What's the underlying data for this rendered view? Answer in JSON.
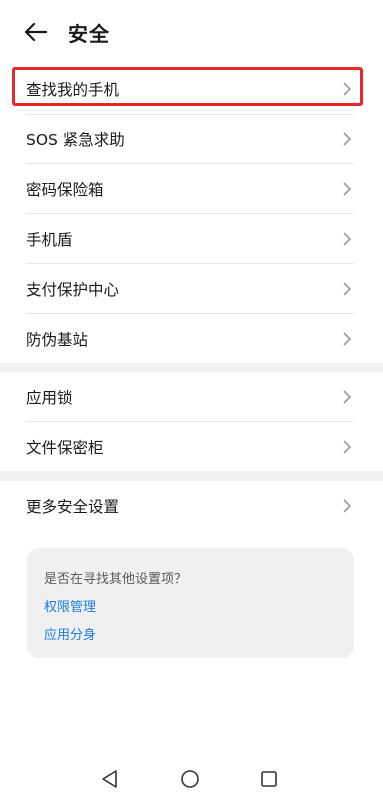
{
  "header": {
    "title": "安全",
    "back_icon": "arrow-left-icon"
  },
  "groups": [
    {
      "items": [
        {
          "label": "查找我的手机",
          "highlighted": true
        },
        {
          "label": "SOS 紧急求助"
        },
        {
          "label": "密码保险箱"
        },
        {
          "label": "手机盾"
        },
        {
          "label": "支付保护中心"
        },
        {
          "label": "防伪基站"
        }
      ]
    },
    {
      "items": [
        {
          "label": "应用锁"
        },
        {
          "label": "文件保密柜"
        }
      ]
    },
    {
      "items": [
        {
          "label": "更多安全设置"
        }
      ]
    }
  ],
  "suggestion": {
    "question": "是否在寻找其他设置项？",
    "links": [
      "权限管理",
      "应用分身"
    ]
  },
  "colors": {
    "highlight_border": "#e8282d",
    "link": "#1a7fe0",
    "background": "#f1f1f1"
  },
  "navbar": {
    "icons": [
      "triangle-back-icon",
      "circle-home-icon",
      "square-recent-icon"
    ]
  }
}
